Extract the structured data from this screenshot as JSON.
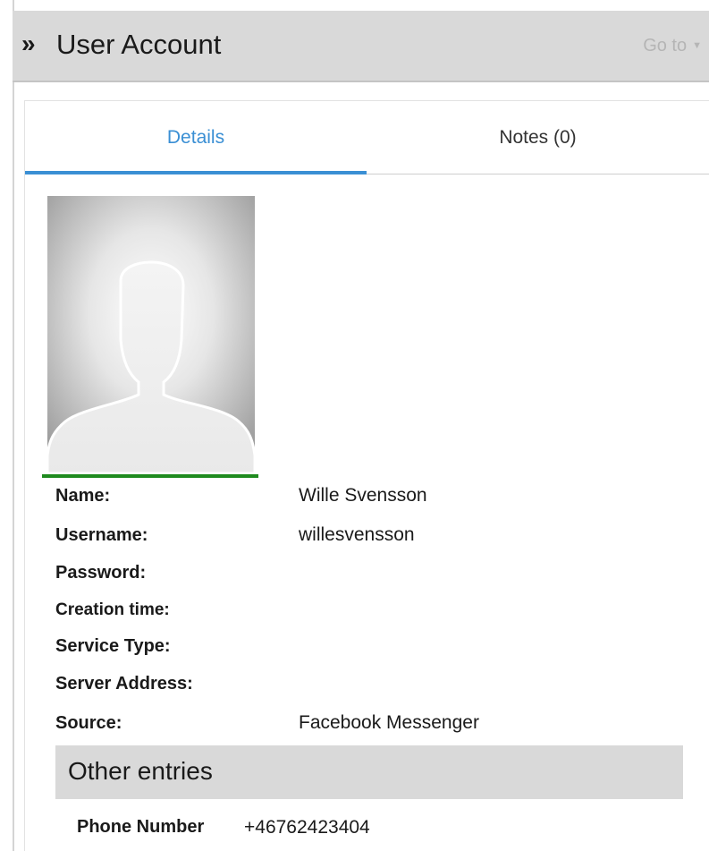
{
  "header": {
    "chevron": "»",
    "title": "User Account",
    "goto_label": "Go to",
    "goto_caret": "▼"
  },
  "tabs": [
    {
      "label": "Details",
      "active": true
    },
    {
      "label": "Notes (0)",
      "active": false
    }
  ],
  "avatar": {
    "icon": "default-user-silhouette",
    "status_color": "#1e8a1e"
  },
  "details": [
    {
      "label": "Name:",
      "value": "Wille Svensson"
    },
    {
      "label": "Username:",
      "value": "willesvensson"
    },
    {
      "label": "Password:",
      "value": ""
    },
    {
      "label": "Creation time:",
      "value": ""
    },
    {
      "label": "Service Type:",
      "value": ""
    },
    {
      "label": "Server Address:",
      "value": ""
    },
    {
      "label": "Source:",
      "value": "Facebook Messenger"
    }
  ],
  "other_entries": {
    "title": "Other entries",
    "items": [
      {
        "label": "Phone Number",
        "value": "+46762423404"
      }
    ]
  },
  "colors": {
    "accent": "#3a8fd4",
    "header_bg": "#d9d9d9",
    "status_green": "#1e8a1e"
  }
}
